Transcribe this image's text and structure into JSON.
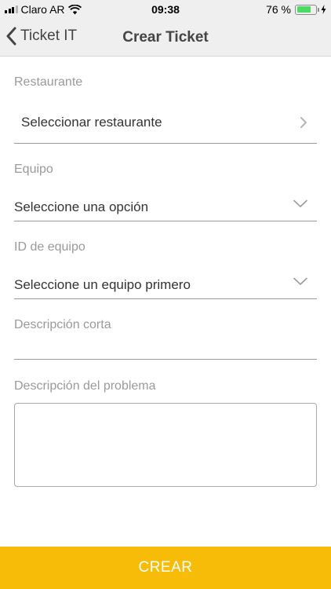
{
  "status_bar": {
    "carrier": "Claro AR",
    "time": "09:38",
    "battery_percent": "76 %",
    "battery_level": 0.76,
    "icons": [
      "signal-icon",
      "wifi-icon",
      "battery-icon",
      "charging-icon"
    ]
  },
  "nav": {
    "back_label": "Ticket IT",
    "title": "Crear Ticket"
  },
  "form": {
    "restaurante": {
      "label": "Restaurante",
      "value": "Seleccionar restaurante"
    },
    "equipo": {
      "label": "Equipo",
      "value": "Seleccione una opción"
    },
    "id_equipo": {
      "label": "ID de equipo",
      "value": "Seleccione un equipo primero"
    },
    "descripcion_corta": {
      "label": "Descripción corta",
      "value": ""
    },
    "descripcion_problema": {
      "label": "Descripción del problema",
      "value": ""
    }
  },
  "submit_label": "CREAR",
  "colors": {
    "accent": "#f6bc08",
    "nav_bg": "#efefef",
    "battery": "#4cd964"
  }
}
